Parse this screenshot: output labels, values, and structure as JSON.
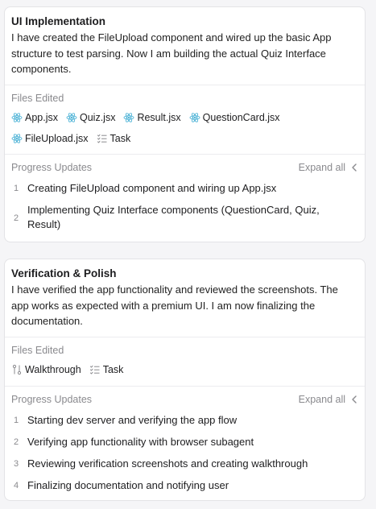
{
  "cards": [
    {
      "title": "UI Implementation",
      "description": "I have created the FileUpload component and wired up the basic App structure to test parsing. Now I am building the actual Quiz Interface components.",
      "files_label": "Files Edited",
      "files": [
        {
          "name": "App.jsx",
          "icon": "react-icon"
        },
        {
          "name": "Quiz.jsx",
          "icon": "react-icon"
        },
        {
          "name": "Result.jsx",
          "icon": "react-icon"
        },
        {
          "name": "QuestionCard.jsx",
          "icon": "react-icon"
        },
        {
          "name": "FileUpload.jsx",
          "icon": "react-icon"
        },
        {
          "name": "Task",
          "icon": "checklist-icon"
        }
      ],
      "progress_label": "Progress Updates",
      "expand_label": "Expand all",
      "steps": [
        {
          "num": "1",
          "text": "Creating FileUpload component and wiring up App.jsx"
        },
        {
          "num": "2",
          "text": "Implementing Quiz Interface components (QuestionCard, Quiz, Result)"
        }
      ]
    },
    {
      "title": "Verification & Polish",
      "description": "I have verified the app functionality and reviewed the screenshots. The app works as expected with a premium UI. I am now finalizing the documentation.",
      "files_label": "Files Edited",
      "files": [
        {
          "name": "Walkthrough",
          "icon": "walkthrough-icon"
        },
        {
          "name": "Task",
          "icon": "checklist-icon"
        }
      ],
      "progress_label": "Progress Updates",
      "expand_label": "Expand all",
      "steps": [
        {
          "num": "1",
          "text": "Starting dev server and verifying the app flow"
        },
        {
          "num": "2",
          "text": "Verifying app functionality with browser subagent"
        },
        {
          "num": "3",
          "text": "Reviewing verification screenshots and creating walkthrough"
        },
        {
          "num": "4",
          "text": "Finalizing documentation and notifying user"
        }
      ]
    }
  ],
  "colors": {
    "react_icon": "#55b6d8",
    "muted": "#8a8a8e",
    "border": "#e3e3e6"
  }
}
